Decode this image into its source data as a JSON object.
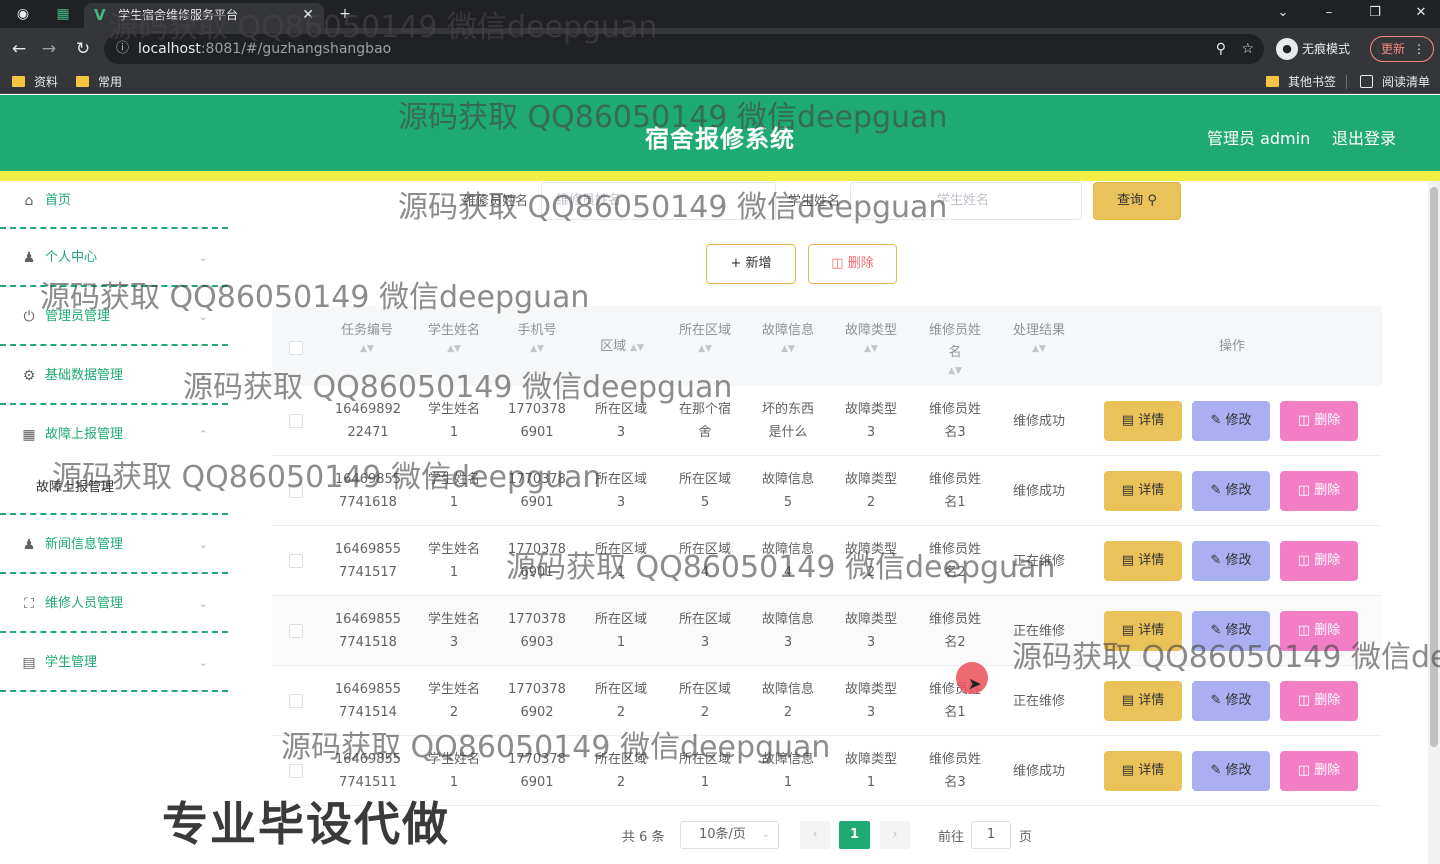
{
  "browser": {
    "tab_title": "学生宿舍维修服务平台",
    "url_host": "localhost",
    "url_path": ":8081/#/guzhangshangbao",
    "incognito_label": "无痕模式",
    "update_label": "更新",
    "bookmarks": [
      "资料",
      "常用"
    ],
    "bookmarks_right": [
      "其他书签",
      "阅读清单"
    ]
  },
  "header": {
    "title": "宿舍报修系统",
    "admin_label": "管理员 admin",
    "logout": "退出登录",
    "color": "#1faa73"
  },
  "sidebar": {
    "items": [
      {
        "label": "首页",
        "icon": "home-icon"
      },
      {
        "label": "个人中心",
        "icon": "user-icon"
      },
      {
        "label": "管理员管理",
        "icon": "power-icon"
      },
      {
        "label": "基础数据管理",
        "icon": "gear-icon"
      },
      {
        "label": "故障上报管理",
        "icon": "chart-icon"
      },
      {
        "label": "新闻信息管理",
        "icon": "user-icon"
      },
      {
        "label": "维修人员管理",
        "icon": "frame-icon"
      },
      {
        "label": "学生管理",
        "icon": "briefcase-icon"
      }
    ],
    "submenu_active": "故障上报管理"
  },
  "search": {
    "repair_label": "维修员姓名",
    "repair_placeholder": "维修员姓名",
    "student_label": "学生姓名",
    "student_placeholder": "学生姓名",
    "query_button": "查询"
  },
  "toolbar": {
    "add": "新增",
    "delete": "删除"
  },
  "table": {
    "headers": [
      "任务编号",
      "学生姓名",
      "手机号",
      "区域",
      "所在区域",
      "故障信息",
      "故障类型",
      "维修员姓名",
      "处理结果",
      "操作"
    ],
    "actions": {
      "detail": "详情",
      "edit": "修改",
      "delete": "删除"
    },
    "rows": [
      {
        "id": [
          "16469892",
          "22471"
        ],
        "student": [
          "学生姓名",
          "1"
        ],
        "phone": [
          "1770378",
          "6901"
        ],
        "area": [
          "所在区域",
          "3"
        ],
        "location": [
          "在那个宿",
          "舍"
        ],
        "info": [
          "坏的东西",
          "是什么"
        ],
        "type": [
          "故障类型",
          "3"
        ],
        "repair": [
          "维修员姓",
          "名3"
        ],
        "result": "维修成功"
      },
      {
        "id": [
          "16469855",
          "7741618"
        ],
        "student": [
          "学生姓名",
          "1"
        ],
        "phone": [
          "1770378",
          "6901"
        ],
        "area": [
          "所在区域",
          "3"
        ],
        "location": [
          "所在区域",
          "5"
        ],
        "info": [
          "故障信息",
          "5"
        ],
        "type": [
          "故障类型",
          "2"
        ],
        "repair": [
          "维修员姓",
          "名1"
        ],
        "result": "维修成功"
      },
      {
        "id": [
          "16469855",
          "7741517"
        ],
        "student": [
          "学生姓名",
          "1"
        ],
        "phone": [
          "1770378",
          "6901"
        ],
        "area": [
          "所在区域",
          "1"
        ],
        "location": [
          "所在区域",
          "4"
        ],
        "info": [
          "故障信息",
          "4"
        ],
        "type": [
          "故障类型",
          "2"
        ],
        "repair": [
          "维修员姓",
          "名2"
        ],
        "result": "正在维修"
      },
      {
        "id": [
          "16469855",
          "7741518"
        ],
        "student": [
          "学生姓名",
          "3"
        ],
        "phone": [
          "1770378",
          "6903"
        ],
        "area": [
          "所在区域",
          "1"
        ],
        "location": [
          "所在区域",
          "3"
        ],
        "info": [
          "故障信息",
          "3"
        ],
        "type": [
          "故障类型",
          "3"
        ],
        "repair": [
          "维修员姓",
          "名2"
        ],
        "result": "正在维修"
      },
      {
        "id": [
          "16469855",
          "7741514"
        ],
        "student": [
          "学生姓名",
          "2"
        ],
        "phone": [
          "1770378",
          "6902"
        ],
        "area": [
          "所在区域",
          "2"
        ],
        "location": [
          "所在区域",
          "2"
        ],
        "info": [
          "故障信息",
          "2"
        ],
        "type": [
          "故障类型",
          "3"
        ],
        "repair": [
          "维修员姓",
          "名1"
        ],
        "result": "正在维修"
      },
      {
        "id": [
          "16469855",
          "7741511"
        ],
        "student": [
          "学生姓名",
          "1"
        ],
        "phone": [
          "1770378",
          "6901"
        ],
        "area": [
          "所在区域",
          "2"
        ],
        "location": [
          "所在区域",
          "1"
        ],
        "info": [
          "故障信息",
          "1"
        ],
        "type": [
          "故障类型",
          "1"
        ],
        "repair": [
          "维修员姓",
          "名3"
        ],
        "result": "维修成功"
      }
    ]
  },
  "pagination": {
    "total": "共 6 条",
    "page_size": "10条/页",
    "current": "1",
    "goto_label": "前往",
    "goto_value": "1",
    "page_suffix": "页"
  },
  "overlays": {
    "watermark": "源码获取 QQ86050149 微信deepguan",
    "watermark_cut": "源码获取 QQ86050149 微信de",
    "promo": "专业毕设代做"
  }
}
